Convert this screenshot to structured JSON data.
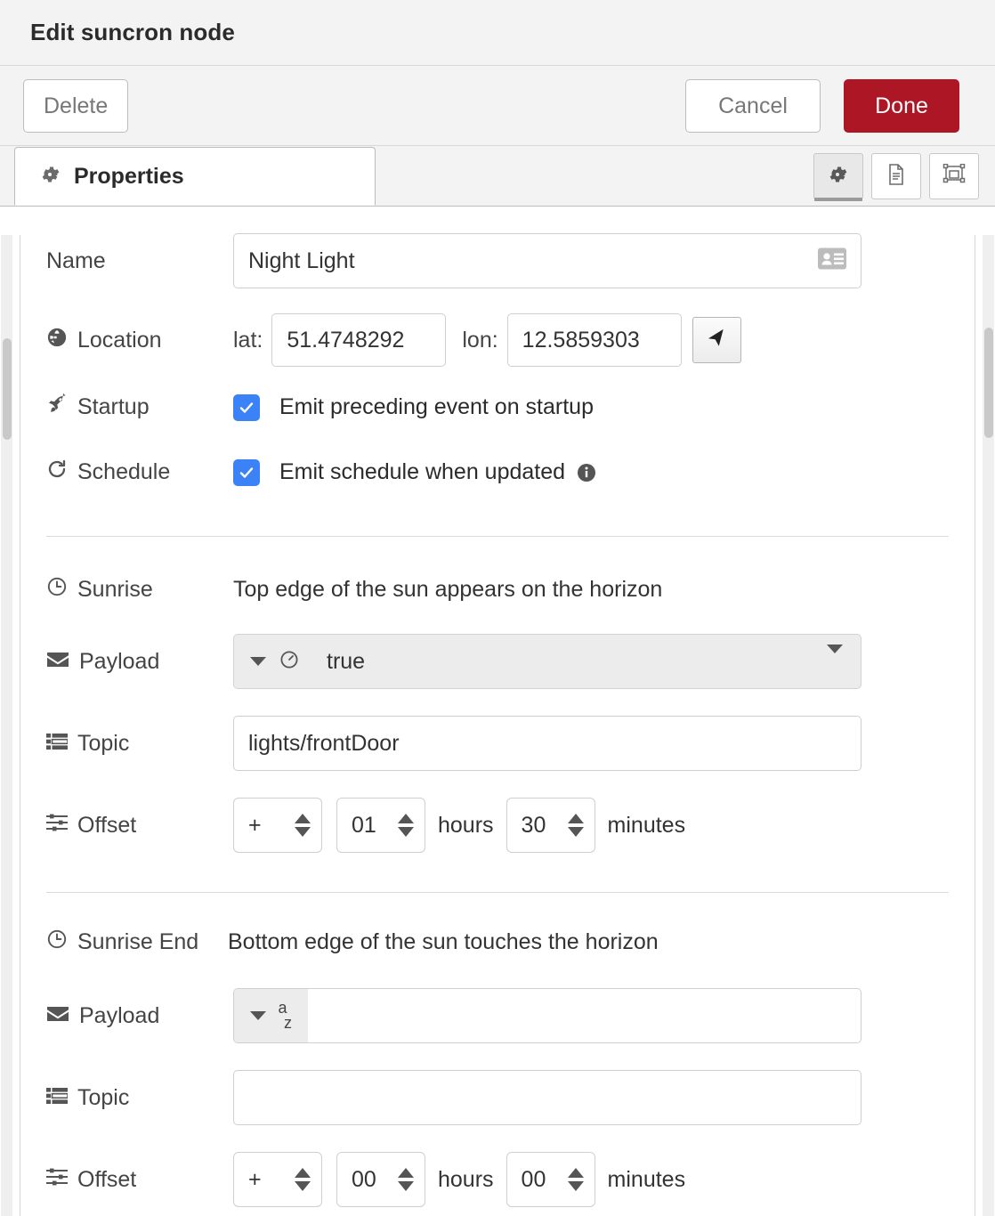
{
  "window": {
    "title": "Edit suncron node"
  },
  "toolbar": {
    "delete_label": "Delete",
    "cancel_label": "Cancel",
    "done_label": "Done",
    "done_color": "#ad1625"
  },
  "tabs": {
    "properties_label": "Properties",
    "icons": [
      "gear-icon",
      "description-icon",
      "appearance-icon"
    ]
  },
  "form": {
    "name": {
      "label": "Name",
      "value": "Night Light",
      "placeholder": ""
    },
    "location": {
      "label": "Location",
      "lat_label": "lat:",
      "lat_value": "51.4748292",
      "lon_label": "lon:",
      "lon_value": "12.5859303"
    },
    "startup": {
      "label": "Startup",
      "checkbox_label": "Emit preceding event on startup",
      "checked": true
    },
    "schedule": {
      "label": "Schedule",
      "checkbox_label": "Emit schedule when updated",
      "checked": true,
      "has_info_icon": true
    }
  },
  "sections": [
    {
      "title": "Sunrise",
      "description": "Top edge of the sun appears on the horizon",
      "payload": {
        "label": "Payload",
        "type_icon": "boolean-icon",
        "value": "true",
        "placeholder": ""
      },
      "topic": {
        "label": "Topic",
        "value": "lights/frontDoor",
        "placeholder": ""
      },
      "offset": {
        "label": "Offset",
        "sign": "+",
        "hours": "01",
        "hours_unit": "hours",
        "minutes": "30",
        "minutes_unit": "minutes"
      }
    },
    {
      "title": "Sunrise End",
      "description": "Bottom edge of the sun touches the horizon",
      "payload": {
        "label": "Payload",
        "type_icon": "string-az-icon",
        "value": "",
        "placeholder": ""
      },
      "topic": {
        "label": "Topic",
        "value": "",
        "placeholder": ""
      },
      "offset": {
        "label": "Offset",
        "sign": "+",
        "hours": "00",
        "hours_unit": "hours",
        "minutes": "00",
        "minutes_unit": "minutes"
      }
    }
  ],
  "colors": {
    "accent_checkbox": "#3b82f6",
    "danger": "#ad1625",
    "panel_bg": "#f3f3f3"
  }
}
